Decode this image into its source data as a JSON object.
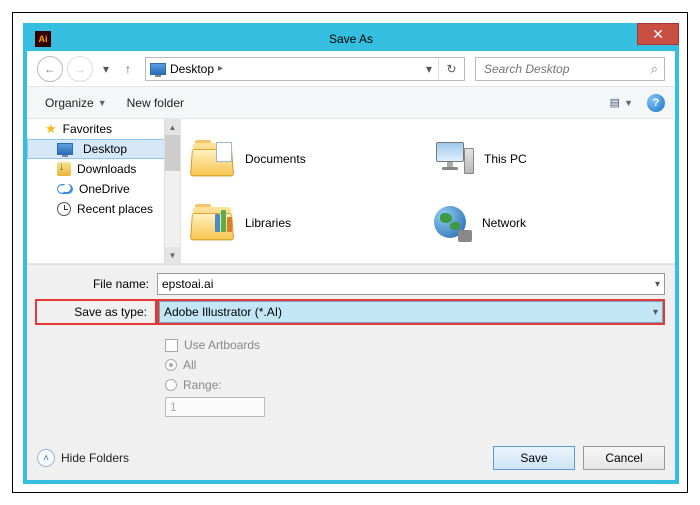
{
  "window": {
    "title": "Save As",
    "app_icon_text": "Ai"
  },
  "nav": {
    "location_label": "Desktop",
    "search_placeholder": "Search Desktop"
  },
  "toolbar": {
    "organize": "Organize",
    "new_folder": "New folder"
  },
  "sidebar": {
    "favorites": "Favorites",
    "items": [
      {
        "label": "Desktop"
      },
      {
        "label": "Downloads"
      },
      {
        "label": "OneDrive"
      },
      {
        "label": "Recent places"
      }
    ]
  },
  "folders": {
    "documents": "Documents",
    "this_pc": "This PC",
    "libraries": "Libraries",
    "network": "Network"
  },
  "form": {
    "file_name_label": "File name:",
    "file_name_value": "epstoai.ai",
    "save_type_label": "Save as type:",
    "save_type_value": "Adobe Illustrator (*.AI)",
    "use_artboards": "Use Artboards",
    "all_label": "All",
    "range_label": "Range:",
    "range_value": "1"
  },
  "footer": {
    "hide_folders": "Hide Folders",
    "save": "Save",
    "cancel": "Cancel"
  }
}
